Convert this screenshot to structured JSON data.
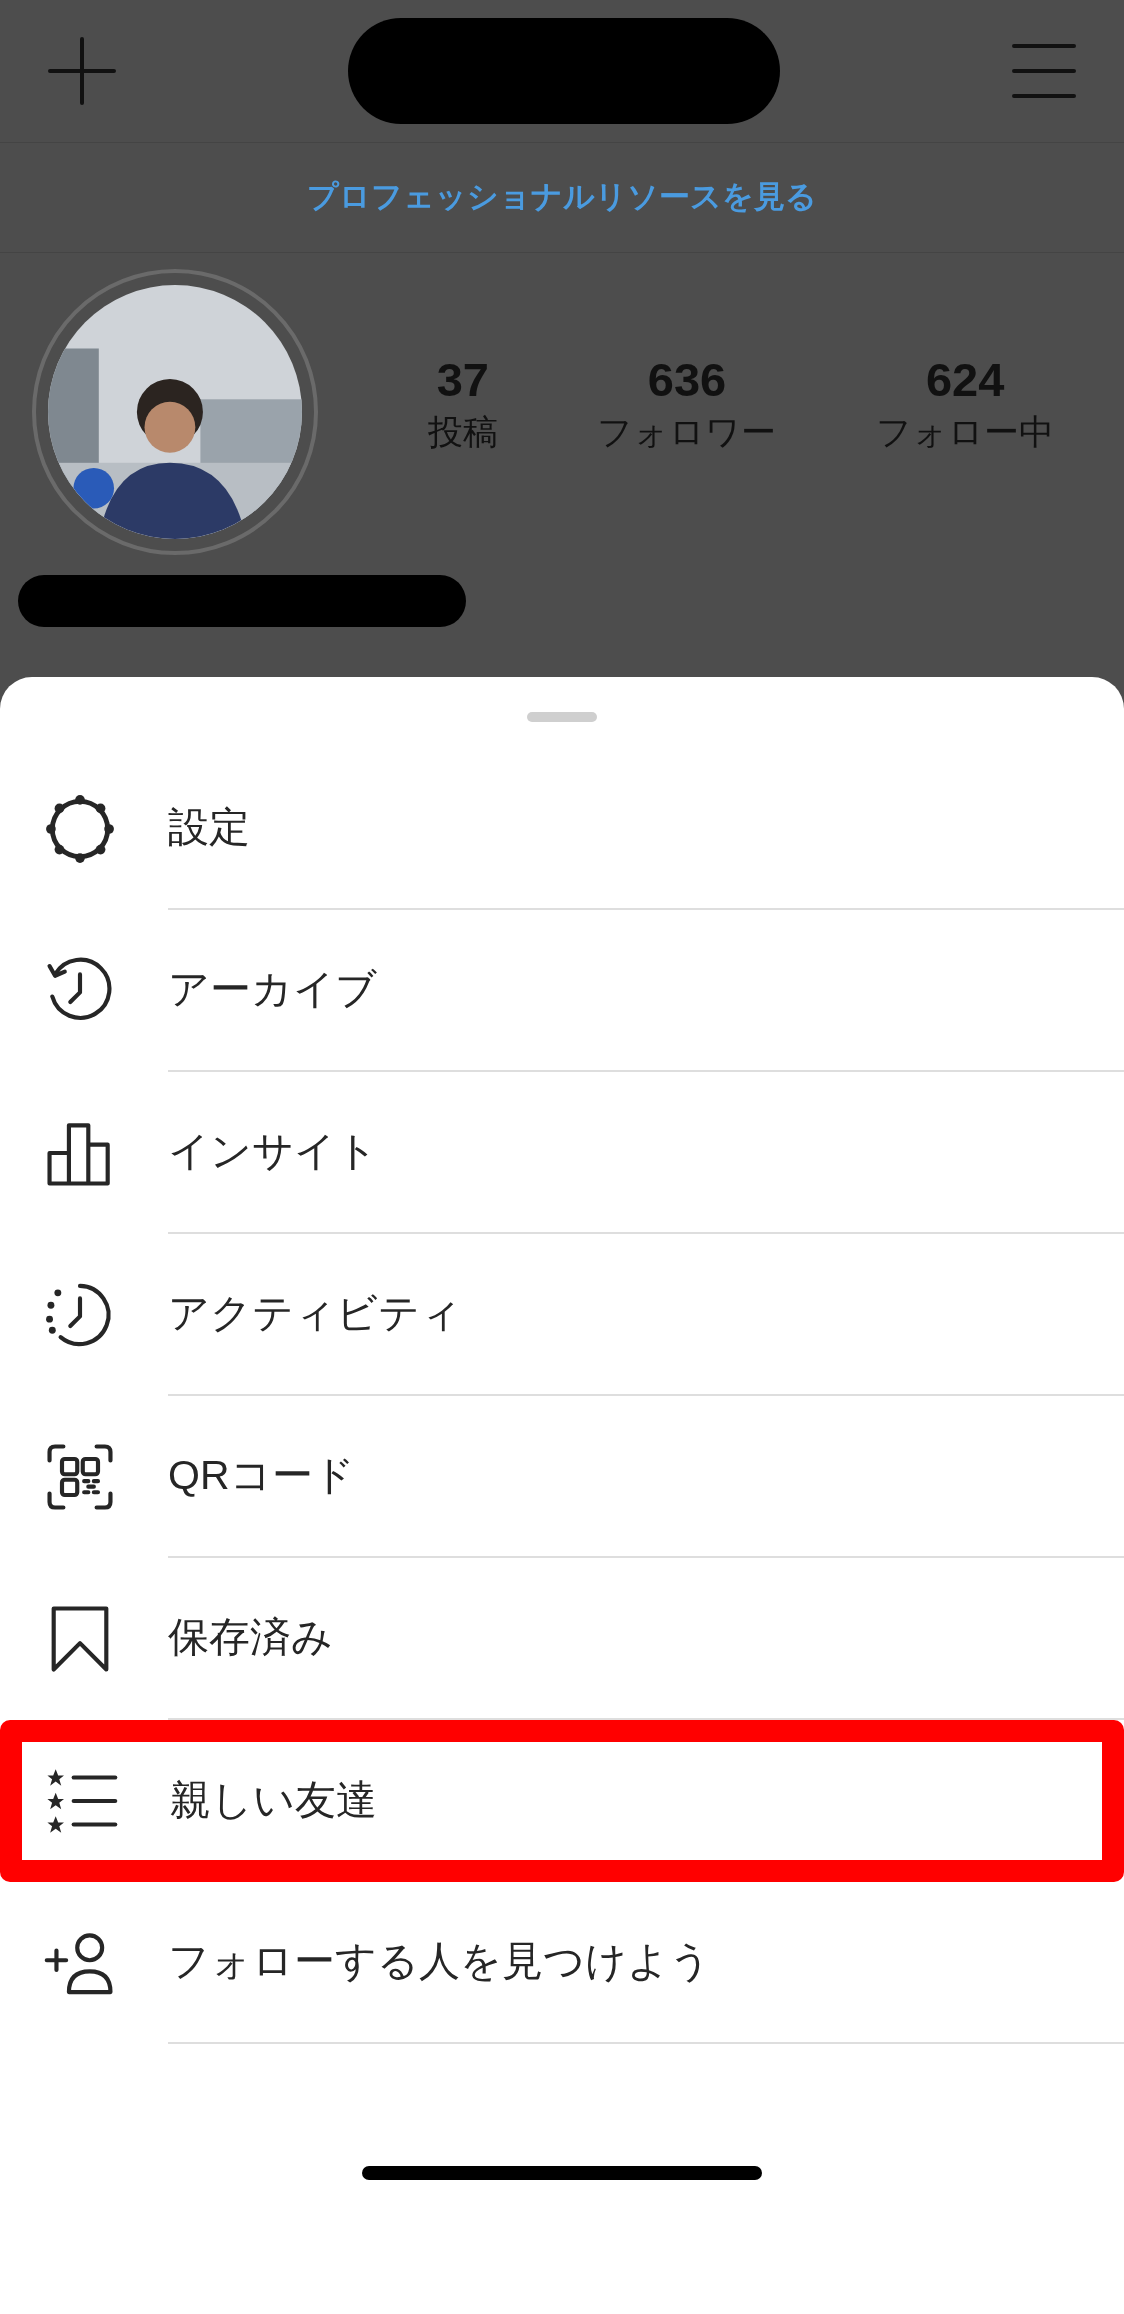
{
  "profile_header": {
    "pro_link": "プロフェッショナルリソースを見る"
  },
  "stats": [
    {
      "value": "37",
      "label": "投稿"
    },
    {
      "value": "636",
      "label": "フォロワー"
    },
    {
      "value": "624",
      "label": "フォロー中"
    }
  ],
  "menu": [
    {
      "kind": "settings",
      "label": "設定",
      "highlighted": false
    },
    {
      "kind": "archive",
      "label": "アーカイブ",
      "highlighted": false
    },
    {
      "kind": "insights",
      "label": "インサイト",
      "highlighted": false
    },
    {
      "kind": "activity",
      "label": "アクティビティ",
      "highlighted": false
    },
    {
      "kind": "qr",
      "label": "QRコード",
      "highlighted": false
    },
    {
      "kind": "saved",
      "label": "保存済み",
      "highlighted": false
    },
    {
      "kind": "close_friends",
      "label": "親しい友達",
      "highlighted": true
    },
    {
      "kind": "discover",
      "label": "フォローする人を見つけよう",
      "highlighted": false
    }
  ]
}
